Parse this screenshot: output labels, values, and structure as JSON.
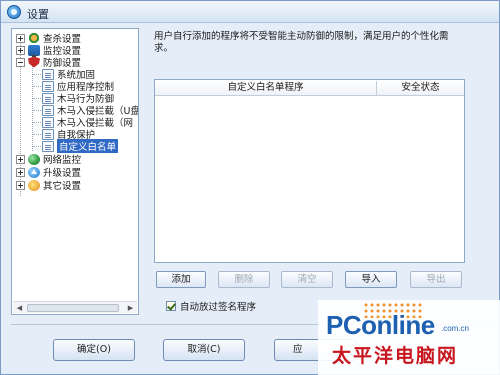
{
  "window": {
    "title": "设置",
    "icon": "app-shield-icon"
  },
  "tree": {
    "items": [
      {
        "label": "查杀设置",
        "icon": "scan-icon",
        "expander": "plus"
      },
      {
        "label": "监控设置",
        "icon": "monitor-icon",
        "expander": "plus"
      },
      {
        "label": "防御设置",
        "icon": "shield-icon",
        "expander": "minus"
      },
      {
        "label": "系统加固",
        "icon": "doc-icon"
      },
      {
        "label": "应用程序控制",
        "icon": "doc-icon"
      },
      {
        "label": "木马行为防御",
        "icon": "doc-icon"
      },
      {
        "label": "木马入侵拦截（U盘",
        "icon": "doc-icon"
      },
      {
        "label": "木马入侵拦截（网",
        "icon": "doc-icon"
      },
      {
        "label": "自我保护",
        "icon": "doc-icon"
      },
      {
        "label": "自定义白名单",
        "icon": "doc-icon",
        "selected": true
      },
      {
        "label": "网络监控",
        "icon": "globe-icon",
        "expander": "plus"
      },
      {
        "label": "升级设置",
        "icon": "update-icon",
        "expander": "plus"
      },
      {
        "label": "其它设置",
        "icon": "other-icon",
        "expander": "plus"
      }
    ]
  },
  "main": {
    "description": "用户自行添加的程序将不受智能主动防御的限制，满足用户的个性化需求。",
    "table": {
      "columns": [
        "自定义白名单程序",
        "安全状态"
      ],
      "rows": []
    },
    "buttons": {
      "add": "添加",
      "delete": "删除",
      "clear": "清空",
      "import": "导入",
      "export": "导出"
    },
    "checkbox": {
      "label": "自动放过签名程序",
      "checked": true
    }
  },
  "footer": {
    "ok": "确定(O)",
    "cancel": "取消(C)",
    "apply": "应"
  },
  "watermark": {
    "brand": "PConline",
    "domain": ".com.cn",
    "chinese": "太平洋电脑网"
  },
  "colors": {
    "window_bg": "#e5eef8",
    "selection": "#316ac5",
    "watermark_blue": "#1d5fb0",
    "watermark_red": "#c7161d"
  }
}
